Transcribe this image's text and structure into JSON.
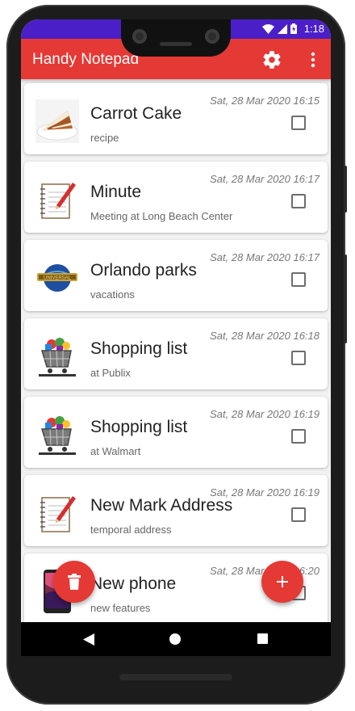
{
  "status_bar": {
    "time": "1:18"
  },
  "app_bar": {
    "title": "Handy Notepad",
    "settings_icon": "gear-icon",
    "menu_icon": "more-vert-icon",
    "color": "#e53935"
  },
  "notes": [
    {
      "title": "Carrot Cake",
      "subtitle": "recipe",
      "date": "Sat, 28 Mar 2020 16:15",
      "thumbnail": "cake-image",
      "checked": false
    },
    {
      "title": "Minute",
      "subtitle": "Meeting at Long Beach Center",
      "date": "Sat, 28 Mar 2020 16:17",
      "thumbnail": "notepad-icon",
      "checked": false
    },
    {
      "title": "Orlando parks",
      "subtitle": "vacations",
      "date": "Sat, 28 Mar 2020 16:17",
      "thumbnail": "universal-logo",
      "checked": false
    },
    {
      "title": "Shopping list",
      "subtitle": "at Publix",
      "date": "Sat, 28 Mar 2020 16:18",
      "thumbnail": "shopping-cart-icon",
      "checked": false
    },
    {
      "title": "Shopping list",
      "subtitle": "at Walmart",
      "date": "Sat, 28 Mar 2020 16:19",
      "thumbnail": "shopping-cart-icon",
      "checked": false
    },
    {
      "title": "New Mark Address",
      "subtitle": "temporal address",
      "date": "Sat, 28 Mar 2020 16:19",
      "thumbnail": "notepad-icon",
      "checked": false
    },
    {
      "title": "New phone",
      "subtitle": "new features",
      "date": "Sat, 28 Mar 2020 16:20",
      "thumbnail": "phone-image",
      "checked": false
    }
  ],
  "fab_delete": {
    "icon": "trash-icon"
  },
  "fab_add": {
    "icon": "plus-icon"
  },
  "navigation": {
    "back": "back-icon",
    "home": "home-icon",
    "recents": "recents-icon"
  }
}
